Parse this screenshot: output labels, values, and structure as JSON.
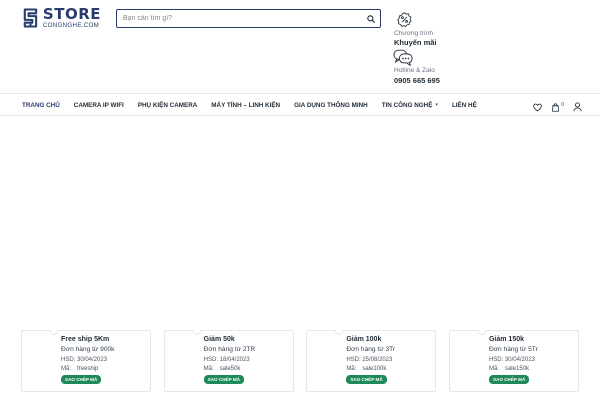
{
  "brand": {
    "logo_main": "STORE",
    "logo_sub": "CONGNGHE.COM",
    "color": "#2a3b6e"
  },
  "search": {
    "placeholder": "Bạn cần tìm gì?",
    "icon": "search-icon"
  },
  "promo": {
    "icon": "discount-icon",
    "subtitle": "Chương trình",
    "title": "Khuyến mãi"
  },
  "hotline": {
    "icon": "chat-icon",
    "subtitle": "Hotline & Zalo",
    "number": "0905 665 695"
  },
  "nav": {
    "items": [
      {
        "label": "TRANG CHỦ",
        "active": true
      },
      {
        "label": "CAMERA IP WIFI"
      },
      {
        "label": "PHỤ KIỆN CAMERA"
      },
      {
        "label": "MÁY TÍNH – LINH KIỆN"
      },
      {
        "label": "GIA DỤNG THÔNG MINH"
      },
      {
        "label": "TIN CÔNG NGHỆ",
        "has_dropdown": true
      },
      {
        "label": "LIÊN HỆ"
      }
    ],
    "caret": "▾",
    "cart_count": "0",
    "icons": [
      "heart-icon",
      "cart-icon",
      "user-icon"
    ]
  },
  "coupons": [
    {
      "title": "Free ship 5Km",
      "desc": "Đơn hàng từ 900k",
      "exp_label": "HSD:",
      "exp": "30/04/2023",
      "code_label": "Mã:",
      "code": "freeship",
      "button": "SAO CHÉP MÃ"
    },
    {
      "title": "Giảm 50k",
      "desc": "Đơn hàng từ 2TR",
      "exp_label": "HSD:",
      "exp": "18/04/2023",
      "code_label": "Mã:",
      "code": "sale50k",
      "button": "SAO CHÉP MÃ"
    },
    {
      "title": "Giảm 100k",
      "desc": "Đơn hàng từ 3Tr",
      "exp_label": "HSD:",
      "exp": "25/08/2023",
      "code_label": "Mã:",
      "code": "sale100k",
      "button": "SAO CHÉP MÃ"
    },
    {
      "title": "Giảm 150k",
      "desc": "Đơn hàng từ 5Tr",
      "exp_label": "HSD:",
      "exp": "30/04/2023",
      "code_label": "Mã:",
      "code": "sale150k",
      "button": "SAO CHÉP MÃ"
    }
  ],
  "colors": {
    "primary": "#2a3b6e",
    "coupon_button": "#1f8a59",
    "border": "#e5e7eb"
  }
}
